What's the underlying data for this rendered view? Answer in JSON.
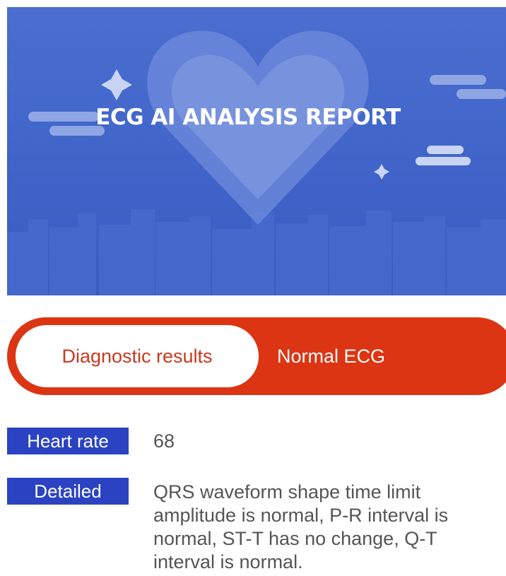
{
  "banner": {
    "title": "ECG AI ANALYSIS REPORT",
    "colors": {
      "background": "#4166cc",
      "accent_shapes": "#7c96de"
    },
    "icons": [
      "heart-icon",
      "sparkle-icon",
      "cloud-icon",
      "city-skyline-icon"
    ]
  },
  "result": {
    "label": "Diagnostic results",
    "value": "Normal ECG",
    "colors": {
      "pill": "#dc3513",
      "label_text": "#c9391e"
    }
  },
  "heart_rate": {
    "label": "Heart rate",
    "value": "68"
  },
  "detailed": {
    "label": "Detailed",
    "text": "QRS waveform shape time limit amplitude is normal, P-R interval is normal, ST-T has no change, Q-T interval is normal."
  },
  "colors": {
    "tag_background": "#2b43c2",
    "body_text": "#555555"
  }
}
